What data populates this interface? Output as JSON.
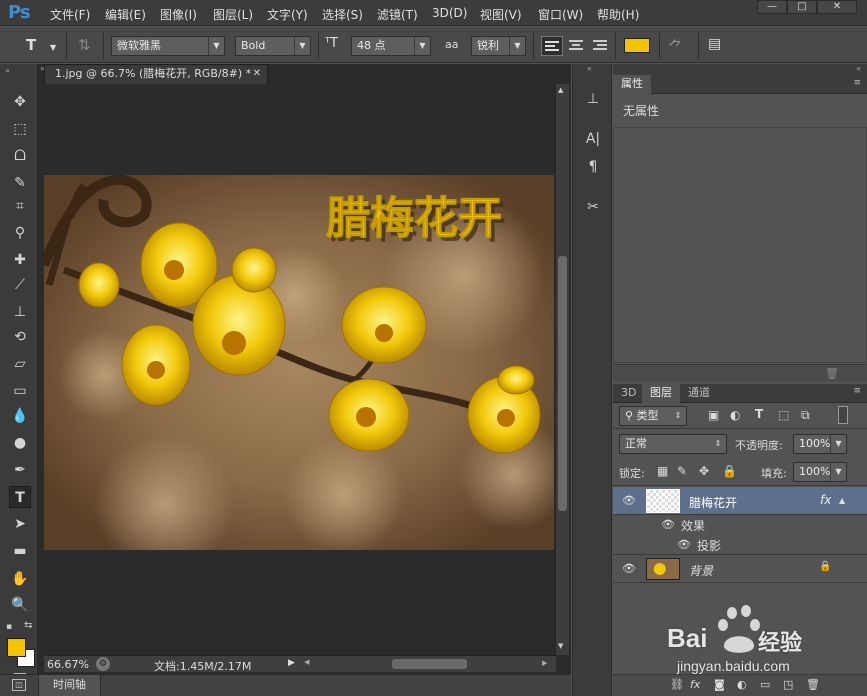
{
  "app": {
    "logo": "Ps"
  },
  "menu": [
    "文件(F)",
    "编辑(E)",
    "图像(I)",
    "图层(L)",
    "文字(Y)",
    "选择(S)",
    "滤镜(T)",
    "3D(D)",
    "视图(V)",
    "窗口(W)",
    "帮助(H)"
  ],
  "window_controls": [
    "—",
    "□",
    "✕"
  ],
  "options": {
    "tool_glyph": "T",
    "font_family": "微软雅黑",
    "font_style": "Bold",
    "font_size": "48 点",
    "antialias": "锐利",
    "aa_glyph": "aa",
    "text_color": "#f5c400"
  },
  "document": {
    "tab_title": "1.jpg @ 66.7% (腊梅花开, RGB/8#) *",
    "canvas_text": "腊梅花开"
  },
  "status": {
    "zoom": "66.67%",
    "doc_info": "文档:1.45M/2.17M"
  },
  "timeline": {
    "label": "时间轴"
  },
  "properties": {
    "tab": "属性",
    "empty_text": "无属性"
  },
  "layers_panel": {
    "tabs": [
      "3D",
      "图层",
      "通道"
    ],
    "filter_kind": "类型",
    "blend_mode": "正常",
    "opacity_label": "不透明度:",
    "opacity_value": "100%",
    "lock_label": "锁定:",
    "fill_label": "填充:",
    "fill_value": "100%",
    "layers": [
      {
        "name": "腊梅花开",
        "fx": "fx"
      },
      {
        "name": "效果"
      },
      {
        "name": "投影"
      },
      {
        "name": "背景"
      }
    ]
  },
  "watermark": {
    "brand": "Bai",
    "brand2": "经验",
    "url": "jingyan.baidu.com"
  },
  "colors": {
    "foreground": "#f5c400",
    "background": "#ffffff",
    "accent": "#3e8ed0"
  }
}
